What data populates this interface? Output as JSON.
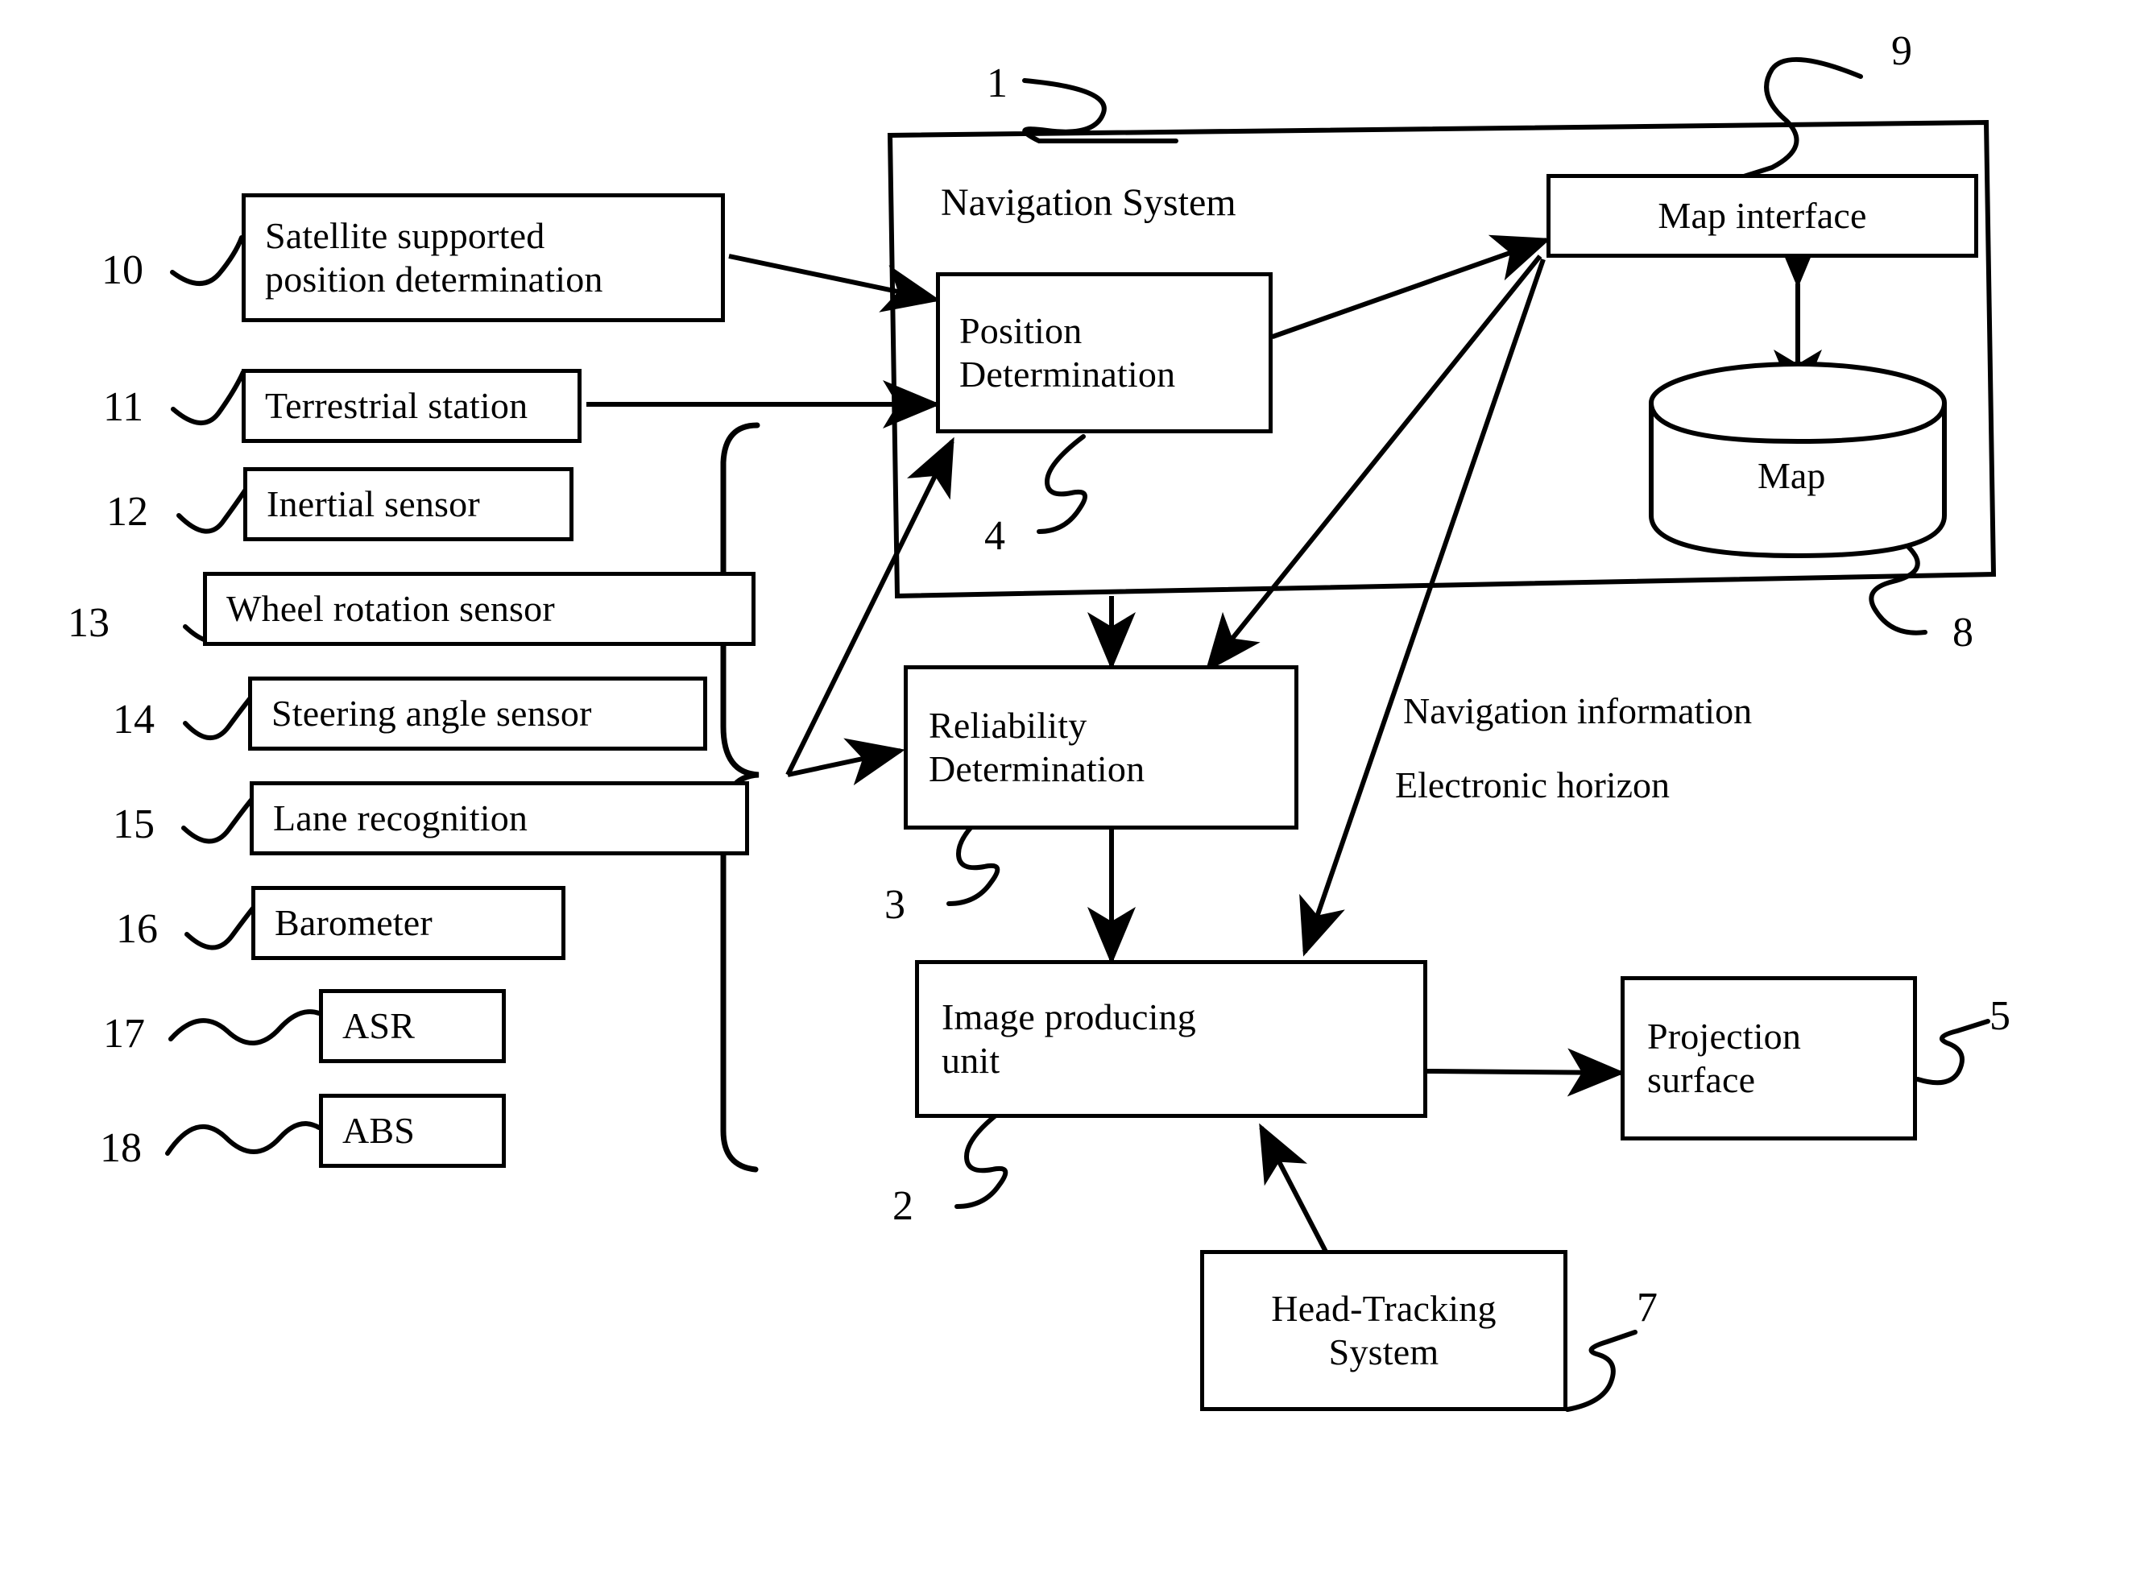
{
  "figure": {
    "type": "patent-block-diagram",
    "title": "Navigation System block diagram"
  },
  "sensors": [
    {
      "ref": "10",
      "label": "Satellite supported position determination",
      "line1": "Satellite supported",
      "line2": "position determination"
    },
    {
      "ref": "11",
      "label": "Terrestrial station",
      "line1": "Terrestrial station",
      "line2": ""
    },
    {
      "ref": "12",
      "label": "Inertial sensor",
      "line1": "Inertial sensor",
      "line2": ""
    },
    {
      "ref": "13",
      "label": "Wheel rotation sensor",
      "line1": "Wheel rotation sensor",
      "line2": ""
    },
    {
      "ref": "14",
      "label": "Steering angle sensor",
      "line1": "Steering angle sensor",
      "line2": ""
    },
    {
      "ref": "15",
      "label": "Lane recognition",
      "line1": "Lane recognition",
      "line2": ""
    },
    {
      "ref": "16",
      "label": "Barometer",
      "line1": "Barometer",
      "line2": ""
    },
    {
      "ref": "17",
      "label": "ASR",
      "line1": "ASR",
      "line2": ""
    },
    {
      "ref": "18",
      "label": "ABS",
      "line1": "ABS",
      "line2": ""
    }
  ],
  "navigation_system": {
    "ref": "1",
    "title": "Navigation System",
    "position_determination": {
      "ref": "4",
      "line1": "Position",
      "line2": "Determination"
    },
    "map_interface": {
      "ref": "9",
      "label": "Map interface"
    },
    "map_store": {
      "ref": "8",
      "label": "Map"
    }
  },
  "reliability_determination": {
    "ref": "3",
    "line1": "Reliability",
    "line2": "Determination"
  },
  "image_producing_unit": {
    "ref": "2",
    "line1": "Image producing",
    "line2": "unit"
  },
  "projection_surface": {
    "ref": "5",
    "line1": "Projection",
    "line2": "surface"
  },
  "head_tracking_system": {
    "ref": "7",
    "line1": "Head-Tracking",
    "line2": "System"
  },
  "annotations": [
    {
      "id": "nav_info",
      "text": "Navigation information"
    },
    {
      "id": "elec_horizon",
      "text": "Electronic horizon"
    }
  ],
  "colors": {
    "stroke": "#000000",
    "background": "#ffffff"
  }
}
